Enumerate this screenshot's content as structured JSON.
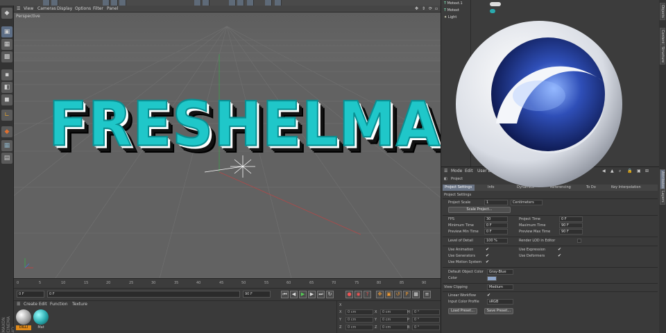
{
  "colors": {
    "accent": "#1fc7c9",
    "tab_active": "#6a7485",
    "viewport": "#626262",
    "panel": "#3a3a3a"
  },
  "viewport_menu": {
    "items": [
      "View",
      "Cameras",
      "Display",
      "Options",
      "Filter",
      "Panel"
    ],
    "label": "Perspective"
  },
  "headline": "FRESHELMAN",
  "timeline": {
    "ticks": [
      "0",
      "5",
      "10",
      "15",
      "20",
      "25",
      "30",
      "35",
      "40",
      "45",
      "50",
      "55",
      "60",
      "65",
      "70",
      "75",
      "80",
      "85",
      "90"
    ]
  },
  "transport": {
    "start": "0 F",
    "current": "0 F",
    "end": "90 F",
    "end2": "90 F"
  },
  "material_menu": {
    "items": [
      "Create",
      "Edit",
      "Function",
      "Texture"
    ]
  },
  "materials": [
    {
      "label": "DILLI",
      "color": "#e0e0e0"
    },
    {
      "label": "Mat",
      "color": "#2aa9ad"
    }
  ],
  "coords": {
    "rows": [
      {
        "axis": "X",
        "v1": "0 cm",
        "a2": "X",
        "v2": "0 cm",
        "a3": "H",
        "v3": "0 °"
      },
      {
        "axis": "Y",
        "v1": "0 cm",
        "a2": "Y",
        "v2": "0 cm",
        "a3": "P",
        "v3": "0 °"
      },
      {
        "axis": "Z",
        "v1": "0 cm",
        "a2": "Z",
        "v2": "0 cm",
        "a3": "B",
        "v3": "0 °"
      }
    ]
  },
  "objects": [
    {
      "name": "Motext.1"
    },
    {
      "name": "Motext"
    },
    {
      "name": "Light"
    }
  ],
  "side_tabs": [
    "Objects",
    "Content Browser",
    "Structure",
    "Attributes",
    "Layers"
  ],
  "attributes": {
    "menu": [
      "Mode",
      "Edit",
      "User Data"
    ],
    "title": "Project",
    "tabs": [
      "Project Settings",
      "Info",
      "Dynamics",
      "Referencing",
      "To Do",
      "Key Interpolation"
    ],
    "section": "Project Settings",
    "project_scale_label": "Project Scale",
    "project_scale_value": "1",
    "project_scale_unit": "Centimeters",
    "scale_button": "Scale Project...",
    "fps_label": "FPS",
    "fps": "30",
    "project_time_label": "Project Time",
    "project_time": "0 F",
    "min_time_label": "Minimum Time",
    "min_time": "0 F",
    "max_time_label": "Maximum Time",
    "max_time": "90 F",
    "prev_min_label": "Preview Min Time",
    "prev_min": "0 F",
    "prev_max_label": "Preview Max Time",
    "prev_max": "90 F",
    "lod_label": "Level of Detail",
    "lod": "100 %",
    "render_lod_label": "Render LOD in Editor",
    "use_animation": "Use Animation",
    "use_expression": "Use Expression",
    "use_generators": "Use Generators",
    "use_deformers": "Use Deformers",
    "use_motion": "Use Motion System",
    "default_color_label": "Default Object Color",
    "default_color": "Gray-Blue",
    "color_label": "Color",
    "view_clipping_label": "View Clipping",
    "view_clipping": "Medium",
    "linear_label": "Linear Workflow",
    "input_profile_label": "Input Color Profile",
    "input_profile": "sRGB",
    "load_button": "Load Preset...",
    "save_button": "Save Preset..."
  },
  "brand_vertical": "MAXON CINEMA 4D"
}
